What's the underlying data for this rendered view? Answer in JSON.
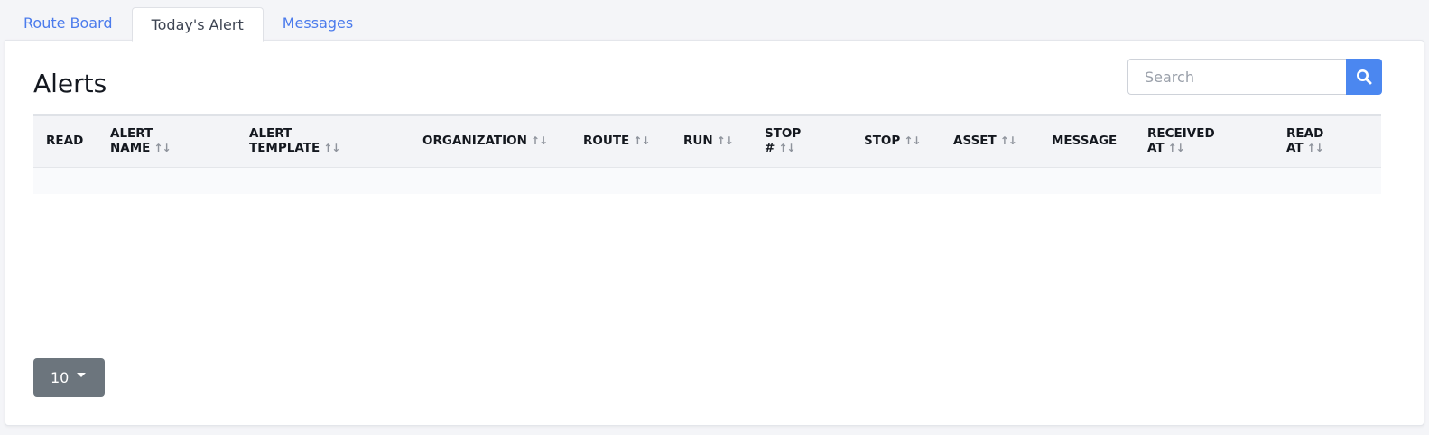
{
  "tabs": [
    {
      "label": "Route Board"
    },
    {
      "label": "Today's Alert"
    },
    {
      "label": "Messages"
    }
  ],
  "card": {
    "title": "Alerts"
  },
  "search": {
    "placeholder": "Search"
  },
  "table": {
    "columns": [
      {
        "line1": "READ",
        "line2": "",
        "sortable": false
      },
      {
        "line1": "ALERT",
        "line2": "NAME",
        "sortable": true
      },
      {
        "line1": "ALERT",
        "line2": "TEMPLATE",
        "sortable": true
      },
      {
        "line1": "ORGANIZATION",
        "line2": "",
        "sortable": true
      },
      {
        "line1": "ROUTE",
        "line2": "",
        "sortable": true
      },
      {
        "line1": "RUN",
        "line2": "",
        "sortable": true
      },
      {
        "line1": "STOP",
        "line2": "#",
        "sortable": true
      },
      {
        "line1": "STOP",
        "line2": "",
        "sortable": true
      },
      {
        "line1": "ASSET",
        "line2": "",
        "sortable": true
      },
      {
        "line1": "MESSAGE",
        "line2": "",
        "sortable": false
      },
      {
        "line1": "RECEIVED",
        "line2": "AT",
        "sortable": true
      },
      {
        "line1": "READ",
        "line2": "AT",
        "sortable": true
      }
    ],
    "sort_icon": "↑↓",
    "rows": []
  },
  "pagination": {
    "page_size": "10"
  },
  "colors": {
    "accent": "#4b87f0",
    "tab_link": "#4b7bec",
    "page_size_button": "#6c757d"
  },
  "icons": {
    "search": "search-icon",
    "dropdown": "caret-down-icon",
    "sort": "sort-icon"
  }
}
